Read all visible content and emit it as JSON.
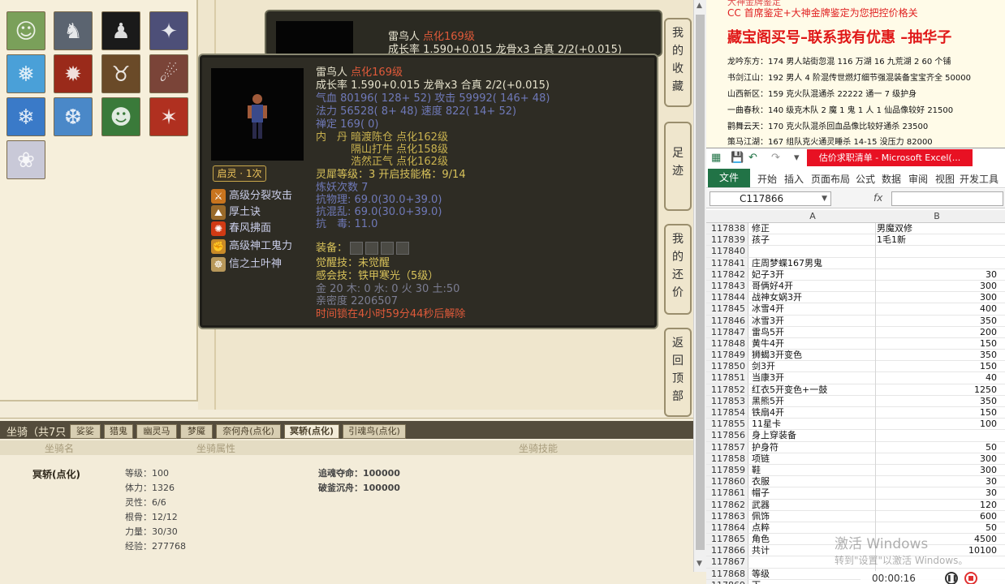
{
  "pets": [
    {
      "name": "pet-portrait-1",
      "color": "#7aa05a",
      "glyph": "☺"
    },
    {
      "name": "pet-portrait-2",
      "color": "#5b6470",
      "glyph": "♞"
    },
    {
      "name": "pet-portrait-3",
      "color": "#1a1a1a",
      "glyph": "♟"
    },
    {
      "name": "pet-portrait-4",
      "color": "#4d4f78",
      "glyph": "✦"
    },
    {
      "name": "pet-portrait-5",
      "color": "#4aa0d8",
      "glyph": "❅"
    },
    {
      "name": "pet-portrait-6",
      "color": "#9a2a1a",
      "glyph": "✹"
    },
    {
      "name": "pet-portrait-7",
      "color": "#6a4a28",
      "glyph": "♉"
    },
    {
      "name": "pet-portrait-8",
      "color": "#7a4438",
      "glyph": "☄"
    },
    {
      "name": "pet-portrait-9",
      "color": "#3a7ac8",
      "glyph": "❄"
    },
    {
      "name": "pet-portrait-10",
      "color": "#4a88c8",
      "glyph": "❆"
    },
    {
      "name": "pet-portrait-11",
      "color": "#3a7a3a",
      "glyph": "☻"
    },
    {
      "name": "pet-portrait-12",
      "color": "#b03020",
      "glyph": "✶"
    },
    {
      "name": "pet-portrait-13",
      "color": "#c9c9d8",
      "glyph": "❀"
    }
  ],
  "back_panel": {
    "name": "雷鸟人",
    "level": "点化169级",
    "line2": "成长率 1.590+0.015 龙骨x3 合真 2/2(+0.015)"
  },
  "side_buttons": [
    {
      "chars": [
        "我",
        "的",
        "收",
        "藏"
      ]
    },
    {
      "chars": [
        "足",
        "迹"
      ]
    },
    {
      "chars": [
        "我",
        "的",
        "还",
        "价"
      ]
    },
    {
      "chars": [
        "返",
        "回",
        "顶",
        "部"
      ]
    }
  ],
  "tooltip": {
    "name": "雷鸟人",
    "level": "点化169级",
    "growth": "成长率 1.590+0.015 龙骨x3 合真 2/2(+0.015)",
    "hp": "气血 80196( 128+ 52) 攻击 59992( 146+ 48)",
    "mp": "法力 56528( 8+ 48) 速度 822( 14+ 52)",
    "zen": "禅定 169( 0)",
    "neidan_label": "内　丹",
    "neidan": [
      "暗渡陈仓 点化162级",
      "隔山打牛 点化158级",
      "浩然正气 点化162级"
    ],
    "lingxi": "灵犀等级：3 开启技能格：9/14",
    "lianyao": "炼妖次数 7",
    "kangwuli": "抗物理: 69.0(30.0+39.0)",
    "kanghunluan": "抗混乱: 69.0(30.0+39.0)",
    "kangdu": "抗　毒: 11.0",
    "equip_label": "装备：",
    "awaken_skill": "觉醒技：未觉醒",
    "resonance": "感会技：铁甲寒光（5级）",
    "elements": "金 20 木: 0 水: 0 火 30 土:50",
    "intimacy": "亲密度 2206507",
    "timer": "时间锁在4小时59分44秒后解除",
    "awaken_tag": "启灵 · 1次",
    "skills": [
      {
        "label": "高级分裂攻击",
        "color": "#c8741e",
        "glyph": "⚔"
      },
      {
        "label": "厚土诀",
        "color": "#9a6a2a",
        "glyph": "⛰"
      },
      {
        "label": "春风拂面",
        "color": "#d03a14",
        "glyph": "✺"
      },
      {
        "label": "高级神工鬼力",
        "color": "#c88a28",
        "glyph": "✊"
      },
      {
        "label": "信之土叶神",
        "color": "#b8985a",
        "glyph": "☸"
      }
    ]
  },
  "mount": {
    "title": "坐骑（共7只",
    "tabs": [
      "娑娑",
      "猎鬼",
      "幽灵马",
      "梦魇",
      "奈何舟(点化)",
      "冥轿(点化)",
      "引魂鸟(点化)"
    ],
    "active_tab": 5,
    "headers": [
      "坐骑名",
      "坐骑属性",
      "坐骑技能"
    ],
    "name": "冥轿(点化)",
    "attrs": [
      "等级：100",
      "体力：1326",
      "灵性：6/6",
      "根骨：12/12",
      "力量：30/30",
      "经验：277768"
    ],
    "skills": [
      "追魂夺命：100000",
      "破釜沉舟：100000"
    ]
  },
  "notes": {
    "top_small": "大神金牌鉴定",
    "line1": "CC 首席鉴定+大神金牌鉴定为您把控价格关",
    "headline": "藏宝阁买号–联系我有优惠 –抽华子",
    "items": [
      "龙吟东方：174 男人站街忽混 116 万湖 16 九荒湖 2 60 个铺",
      "书剑江山：192 男人 4 阶混传世燃灯细节强混装备宝宝齐全 50000",
      "山西新区：159 克火队混通杀 22222 通一 7 级护身",
      "一曲春秋：140 级克木队 2 魔 1 鬼 1 人 1 仙品像较好 21500",
      "鹳舞云天：170 克火队混杀回血品像比较好通杀 23500",
      "策马江湖：167 组队克火通灵睡杀 14-15 没压力 82000"
    ]
  },
  "excel": {
    "doc_title": "估价求职清单 - Microsoft Excel(...",
    "file_tab": "文件",
    "tabs": [
      "开始",
      "插入",
      "页面布局",
      "公式",
      "数据",
      "审阅",
      "视图",
      "开发工具"
    ],
    "namebox": "C117866",
    "fx": "fx",
    "col_headers": [
      "A",
      "B"
    ],
    "rows": [
      {
        "n": "117838",
        "a": "修正",
        "b": "男魔双修",
        "num": false
      },
      {
        "n": "117839",
        "a": "孩子",
        "b": "1毛1新",
        "num": false
      },
      {
        "n": "117840",
        "a": "",
        "b": "",
        "num": false
      },
      {
        "n": "117841",
        "a": "庄周梦蝶167男鬼",
        "b": "",
        "num": false
      },
      {
        "n": "117842",
        "a": "妃子3开",
        "b": "30",
        "num": true
      },
      {
        "n": "117843",
        "a": "哥俩好4开",
        "b": "300",
        "num": true
      },
      {
        "n": "117844",
        "a": "战神女娲3开",
        "b": "300",
        "num": true
      },
      {
        "n": "117845",
        "a": "冰雪4开",
        "b": "400",
        "num": true
      },
      {
        "n": "117846",
        "a": "冰雪3开",
        "b": "350",
        "num": true
      },
      {
        "n": "117847",
        "a": "雷鸟5开",
        "b": "200",
        "num": true
      },
      {
        "n": "117848",
        "a": "黄牛4开",
        "b": "150",
        "num": true
      },
      {
        "n": "117849",
        "a": "狮蝎3开变色",
        "b": "350",
        "num": true
      },
      {
        "n": "117850",
        "a": "剑3开",
        "b": "150",
        "num": true
      },
      {
        "n": "117851",
        "a": "当康3开",
        "b": "40",
        "num": true
      },
      {
        "n": "117852",
        "a": "红衣5开变色+一鼓",
        "b": "1250",
        "num": true
      },
      {
        "n": "117853",
        "a": "黑熊5开",
        "b": "350",
        "num": true
      },
      {
        "n": "117854",
        "a": "铁扇4开",
        "b": "150",
        "num": true
      },
      {
        "n": "117855",
        "a": "11星卡",
        "b": "100",
        "num": true
      },
      {
        "n": "117856",
        "a": "身上穿装备",
        "b": "",
        "num": false
      },
      {
        "n": "117857",
        "a": "护身符",
        "b": "50",
        "num": true
      },
      {
        "n": "117858",
        "a": "项链",
        "b": "300",
        "num": true
      },
      {
        "n": "117859",
        "a": "鞋",
        "b": "300",
        "num": true
      },
      {
        "n": "117860",
        "a": "衣服",
        "b": "30",
        "num": true
      },
      {
        "n": "117861",
        "a": "帽子",
        "b": "30",
        "num": true
      },
      {
        "n": "117862",
        "a": "武器",
        "b": "120",
        "num": true
      },
      {
        "n": "117863",
        "a": "佩饰",
        "b": "600",
        "num": true
      },
      {
        "n": "117864",
        "a": "点粹",
        "b": "50",
        "num": true
      },
      {
        "n": "117865",
        "a": "角色",
        "b": "4500",
        "num": true
      },
      {
        "n": "117866",
        "a": "共计",
        "b": "10100",
        "num": true
      },
      {
        "n": "117867",
        "a": "",
        "b": "",
        "num": false
      },
      {
        "n": "117868",
        "a": "等级",
        "b": "",
        "num": false
      },
      {
        "n": "117869",
        "a": "下一",
        "b": "",
        "num": false
      }
    ]
  },
  "watermark": {
    "line1": "激活 Windows",
    "line2": "转到\"设置\"以激活 Windows。"
  },
  "recorder": {
    "time": "00:00:16"
  }
}
